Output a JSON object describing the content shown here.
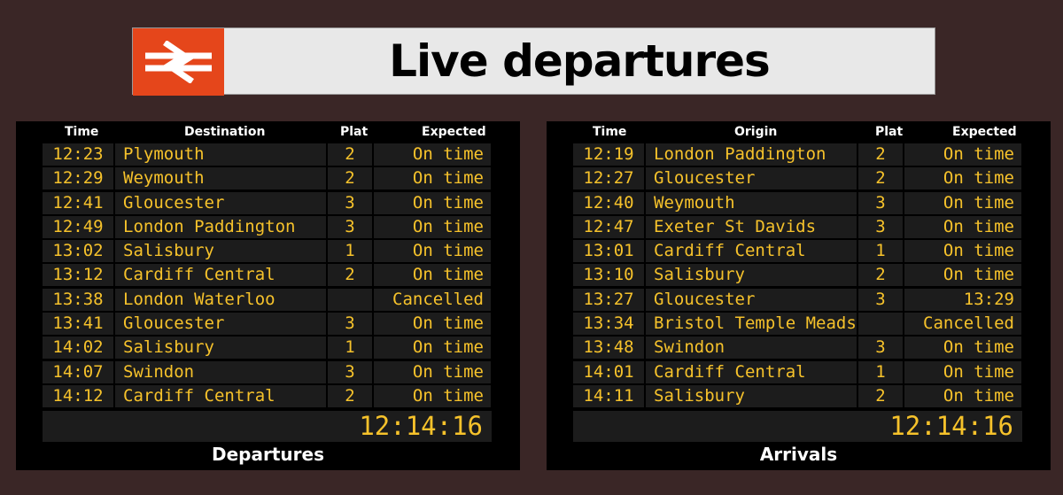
{
  "banner": {
    "title": "Live departures"
  },
  "departures": {
    "label": "Departures",
    "headers": {
      "time": "Time",
      "place": "Destination",
      "plat": "Plat",
      "expected": "Expected"
    },
    "clock": "12:14:16",
    "rows": [
      {
        "time": "12:23",
        "place": "Plymouth",
        "plat": "2",
        "expected": "On time"
      },
      {
        "time": "12:29",
        "place": "Weymouth",
        "plat": "2",
        "expected": "On time"
      },
      {
        "time": "12:41",
        "place": "Gloucester",
        "plat": "3",
        "expected": "On time"
      },
      {
        "time": "12:49",
        "place": "London Paddington",
        "plat": "3",
        "expected": "On time"
      },
      {
        "time": "13:02",
        "place": "Salisbury",
        "plat": "1",
        "expected": "On time"
      },
      {
        "time": "13:12",
        "place": "Cardiff Central",
        "plat": "2",
        "expected": "On time"
      },
      {
        "time": "13:38",
        "place": "London Waterloo",
        "plat": "",
        "expected": "Cancelled"
      },
      {
        "time": "13:41",
        "place": "Gloucester",
        "plat": "3",
        "expected": "On time"
      },
      {
        "time": "14:02",
        "place": "Salisbury",
        "plat": "1",
        "expected": "On time"
      },
      {
        "time": "14:07",
        "place": "Swindon",
        "plat": "3",
        "expected": "On time"
      },
      {
        "time": "14:12",
        "place": "Cardiff Central",
        "plat": "2",
        "expected": "On time"
      }
    ]
  },
  "arrivals": {
    "label": "Arrivals",
    "headers": {
      "time": "Time",
      "place": "Origin",
      "plat": "Plat",
      "expected": "Expected"
    },
    "clock": "12:14:16",
    "rows": [
      {
        "time": "12:19",
        "place": "London Paddington",
        "plat": "2",
        "expected": "On time"
      },
      {
        "time": "12:27",
        "place": "Gloucester",
        "plat": "2",
        "expected": "On time"
      },
      {
        "time": "12:40",
        "place": "Weymouth",
        "plat": "3",
        "expected": "On time"
      },
      {
        "time": "12:47",
        "place": "Exeter St Davids",
        "plat": "3",
        "expected": "On time"
      },
      {
        "time": "13:01",
        "place": "Cardiff Central",
        "plat": "1",
        "expected": "On time"
      },
      {
        "time": "13:10",
        "place": "Salisbury",
        "plat": "2",
        "expected": "On time"
      },
      {
        "time": "13:27",
        "place": "Gloucester",
        "plat": "3",
        "expected": "13:29"
      },
      {
        "time": "13:34",
        "place": "Bristol Temple Meads",
        "plat": "",
        "expected": "Cancelled"
      },
      {
        "time": "13:48",
        "place": "Swindon",
        "plat": "3",
        "expected": "On time"
      },
      {
        "time": "14:01",
        "place": "Cardiff Central",
        "plat": "1",
        "expected": "On time"
      },
      {
        "time": "14:11",
        "place": "Salisbury",
        "plat": "2",
        "expected": "On time"
      }
    ]
  },
  "colors": {
    "background": "#3a2626",
    "board": "#000000",
    "cell": "#1c1c1c",
    "text": "#f6c22b",
    "logo": "#e5461b"
  },
  "icons": {
    "logo": "british-rail-double-arrow-icon"
  }
}
